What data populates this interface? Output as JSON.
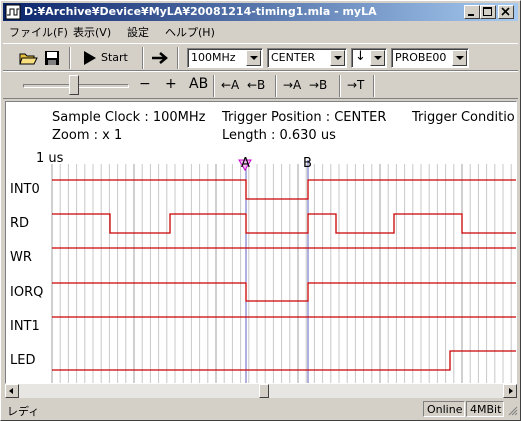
{
  "window": {
    "title": "D:¥Archive¥Device¥MyLA¥20081214-timing1.mla - myLA"
  },
  "menu": [
    "ファイル(F)",
    "表示(V)",
    "設定",
    "ヘルプ(H)"
  ],
  "toolbar": {
    "start_label": "Start",
    "clock_select": "100MHz",
    "trigger_select": "CENTER",
    "edge_select": "↓",
    "probe_select": "PROBE00"
  },
  "toolbar2": {
    "zoom_out": "−",
    "zoom_in": "+",
    "ab_label": "AB",
    "goto_a": "←A",
    "goto_b": "←B",
    "move_a": "→A",
    "move_b": "→B",
    "move_t": "→T"
  },
  "display": {
    "sample_clock": "Sample Clock : 100MHz",
    "trigger_position": "Trigger Position : CENTER",
    "trigger_condition": "Trigger Conditio",
    "zoom": "Zoom : x   1",
    "length": "Length : 0.630 us",
    "time_scale": "1 us",
    "cursor_a": "A",
    "cursor_b": "B",
    "channels": [
      "INT0",
      "RD",
      "WR",
      "IORQ",
      "INT1",
      "LED"
    ],
    "signal_color": "#cc0000",
    "grid_color": "#c8c8c8",
    "cursor_color": "#6060c0",
    "trigger_color": "#cc00cc"
  },
  "status": {
    "text": "レディ",
    "online": "Online",
    "memory": "4MBit"
  }
}
